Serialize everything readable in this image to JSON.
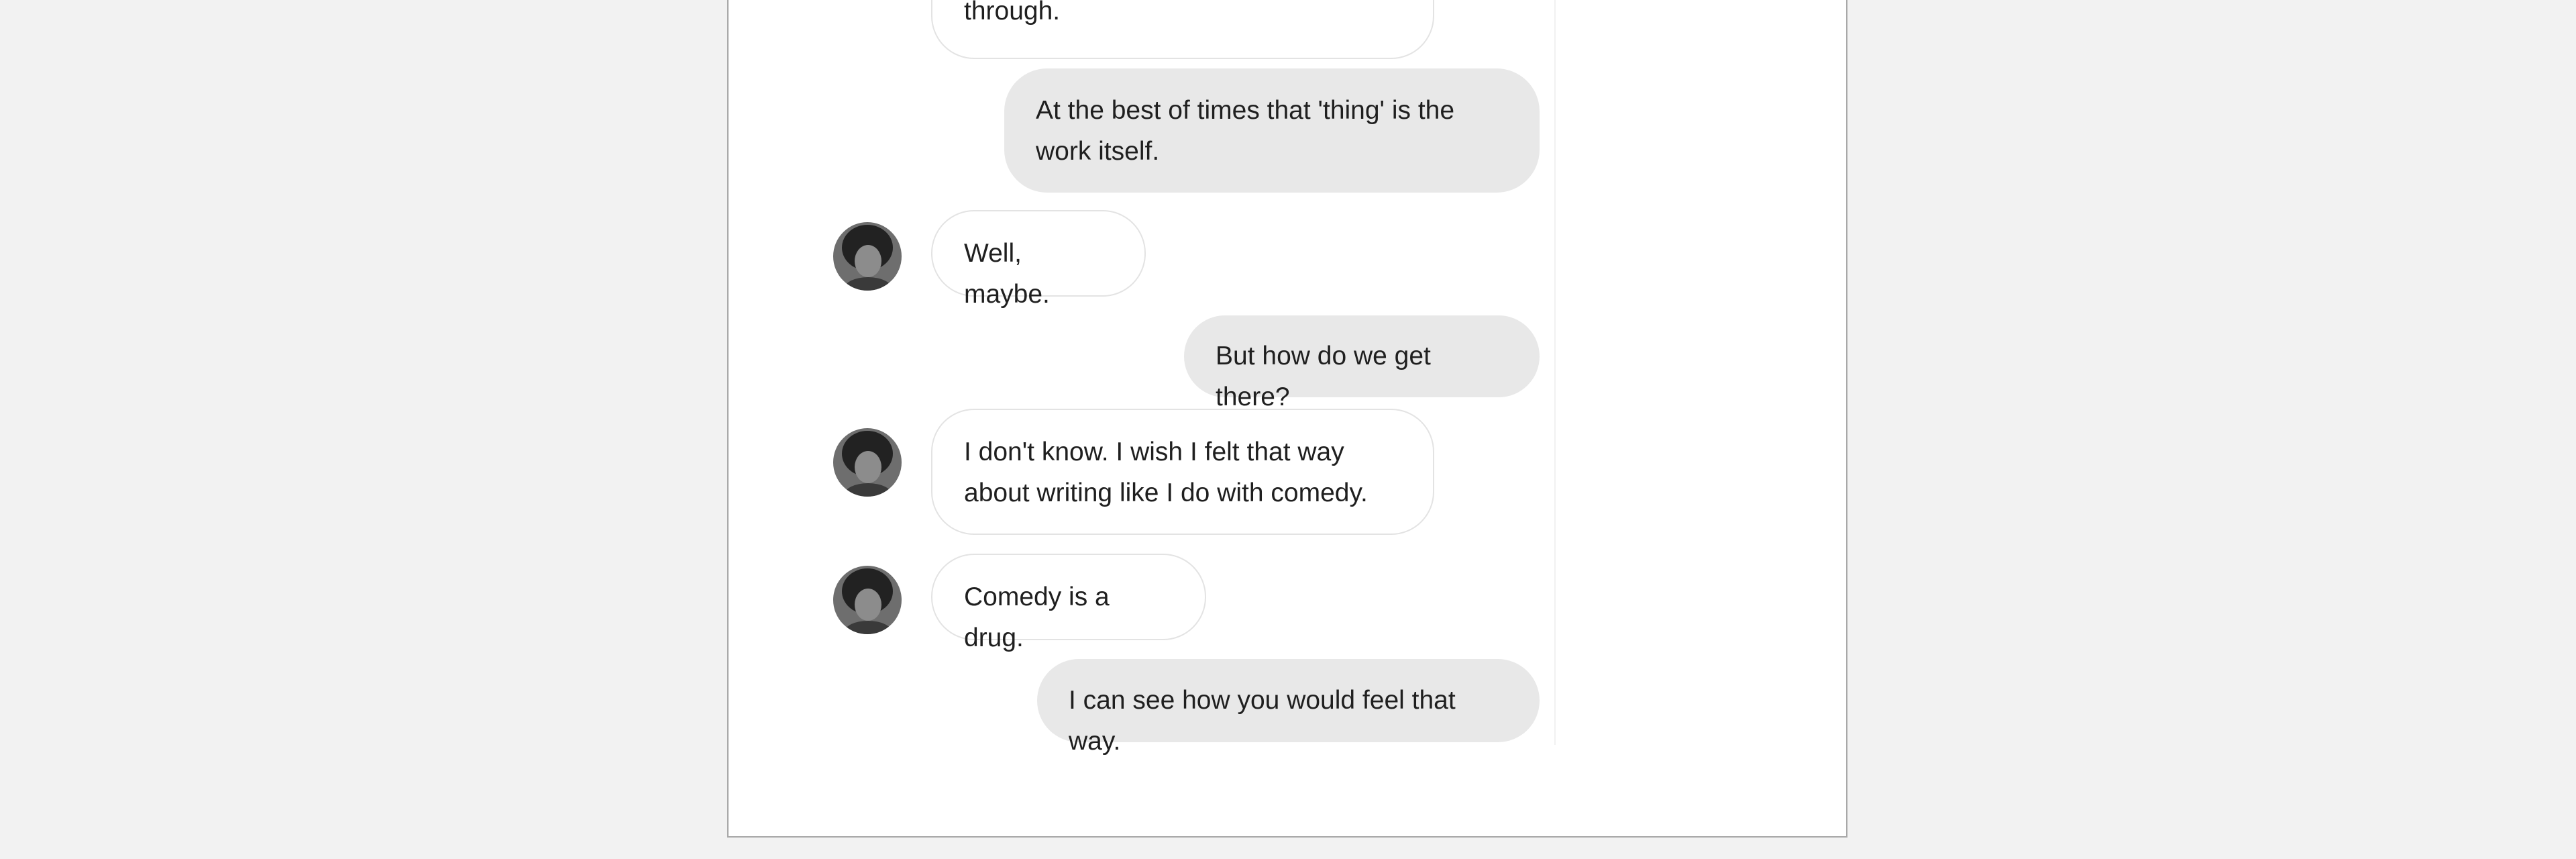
{
  "conversation": {
    "messages": [
      {
        "side": "left",
        "text": "through."
      },
      {
        "side": "right",
        "text": "At the best of times that 'thing' is the work itself."
      },
      {
        "side": "left",
        "text": "Well, maybe."
      },
      {
        "side": "right",
        "text": "But how do we get there?"
      },
      {
        "side": "left",
        "text": "I don't know. I wish I felt that way about writing like I do with comedy."
      },
      {
        "side": "left",
        "text": "Comedy is a drug."
      },
      {
        "side": "right",
        "text": "I can see how you would feel that way."
      }
    ]
  },
  "colors": {
    "background": "#f2f2f2",
    "page": "#ffffff",
    "user_bubble": "#e8e8e8",
    "bot_bubble_border": "#e3e3e3",
    "text": "#1f1f1f"
  },
  "icons": {
    "avatar": "avatar-photo-icon"
  }
}
